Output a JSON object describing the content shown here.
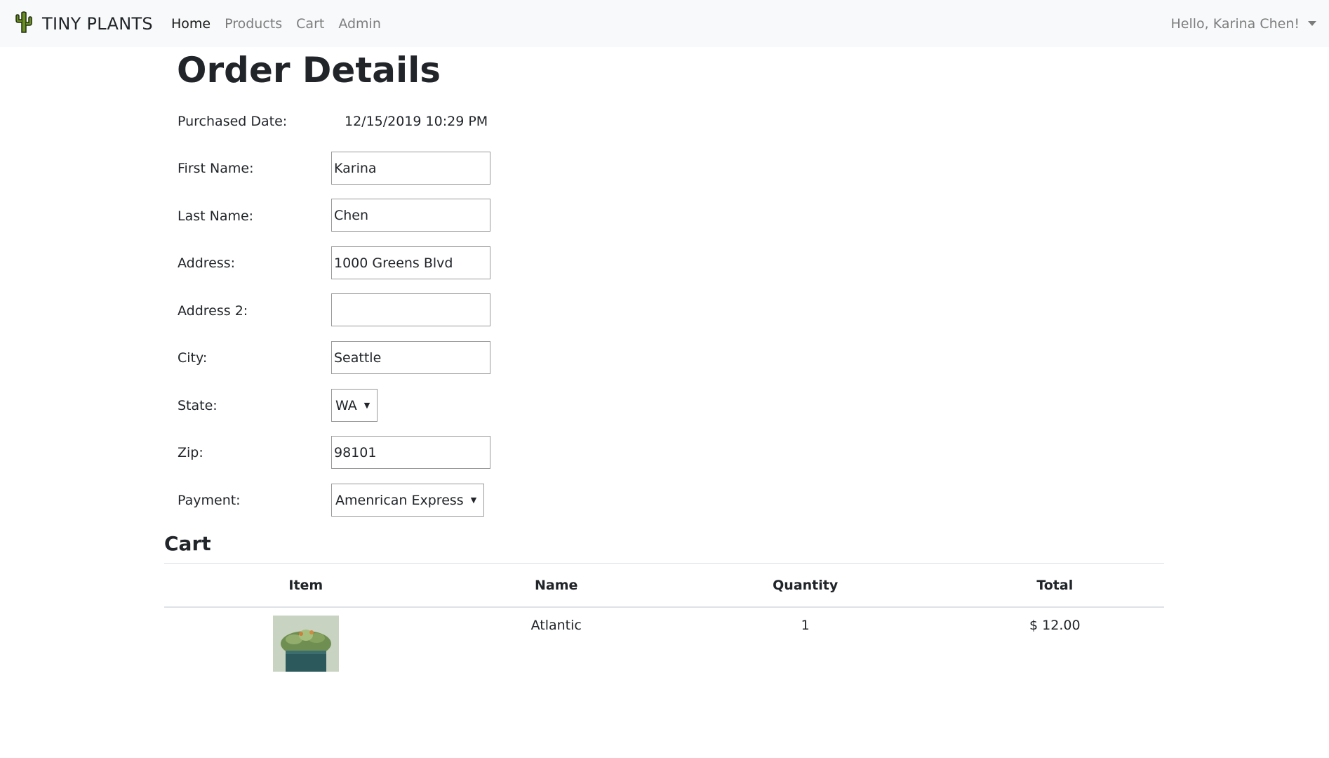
{
  "nav": {
    "brand": "TINY PLANTS",
    "brand_icon": "cactus-icon",
    "links": [
      {
        "label": "Home",
        "active": true
      },
      {
        "label": "Products",
        "active": false
      },
      {
        "label": "Cart",
        "active": false
      },
      {
        "label": "Admin",
        "active": false
      }
    ],
    "user_greeting": "Hello, Karina Chen!"
  },
  "page": {
    "title": "Order Details"
  },
  "order": {
    "purchased_date_label": "Purchased Date:",
    "purchased_date": "12/15/2019 10:29 PM",
    "first_name_label": "First Name:",
    "first_name": "Karina",
    "last_name_label": "Last Name:",
    "last_name": "Chen",
    "address_label": "Address:",
    "address": "1000 Greens Blvd",
    "address2_label": "Address 2:",
    "address2": "",
    "city_label": "City:",
    "city": "Seattle",
    "state_label": "State:",
    "state": "WA",
    "zip_label": "Zip:",
    "zip": "98101",
    "payment_label": "Payment:",
    "payment": "Amenrican Express"
  },
  "cart": {
    "title": "Cart",
    "columns": [
      "Item",
      "Name",
      "Quantity",
      "Total"
    ],
    "rows": [
      {
        "image": "succulent-plant-image",
        "name": "Atlantic",
        "quantity": "1",
        "total": "$ 12.00"
      }
    ]
  },
  "colors": {
    "navbar_bg": "#f8f9fa",
    "text": "#212529",
    "muted_link": "rgba(0,0,0,0.5)"
  }
}
